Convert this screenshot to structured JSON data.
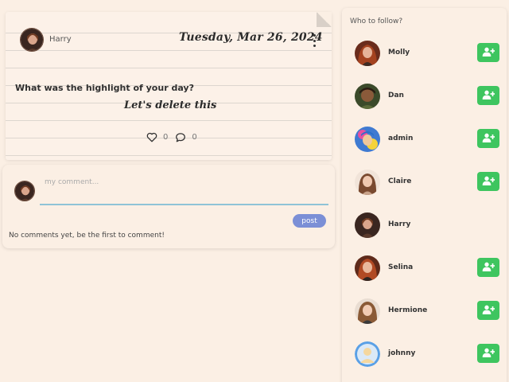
{
  "post": {
    "author": "Harry",
    "date": "Tuesday, Mar 26, 2024",
    "question": "What was the highlight of your day?",
    "note": "Let's delete this",
    "likes": "0",
    "comments": "0"
  },
  "comment_box": {
    "placeholder": "my comment...",
    "post_label": "post",
    "empty_text": "No comments yet, be the first to comment!"
  },
  "follow": {
    "title": "Who to follow?",
    "users": [
      {
        "name": "Molly",
        "show_follow": true
      },
      {
        "name": "Dan",
        "show_follow": true
      },
      {
        "name": "admin",
        "show_follow": true
      },
      {
        "name": "Claire",
        "show_follow": true
      },
      {
        "name": "Harry",
        "show_follow": false
      },
      {
        "name": "Selina",
        "show_follow": true
      },
      {
        "name": "Hermione",
        "show_follow": true
      },
      {
        "name": "johnny",
        "show_follow": true
      }
    ]
  },
  "colors": {
    "background": "#fbefe4",
    "follow_button": "#3ec55f",
    "post_button": "#7b8fd6",
    "input_underline": "#8fc3d6"
  },
  "icons": {
    "like": "heart-icon",
    "comment": "comment-bubble-icon",
    "follow": "user-plus-icon",
    "menu": "kebab-menu-icon"
  }
}
